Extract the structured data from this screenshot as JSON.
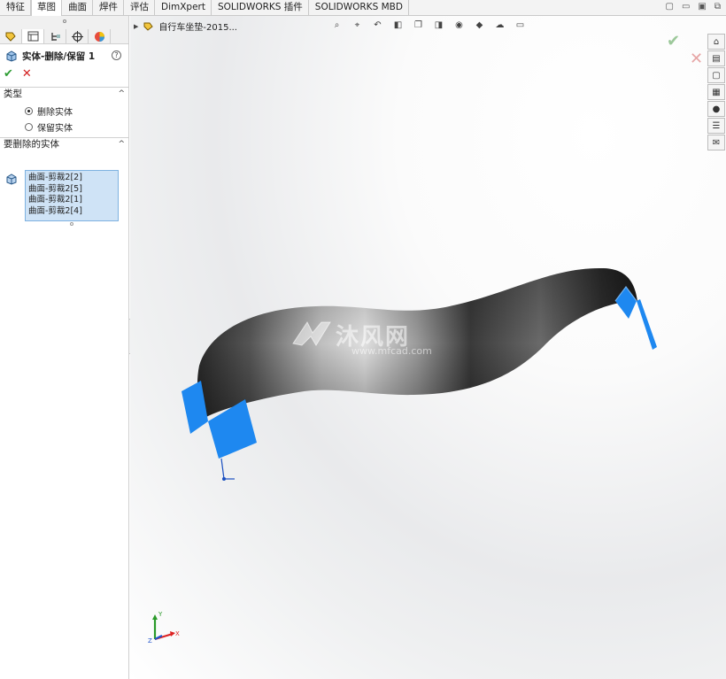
{
  "tabs": [
    {
      "label": "特征",
      "active": false
    },
    {
      "label": "草图",
      "active": true
    },
    {
      "label": "曲面",
      "active": false
    },
    {
      "label": "焊件",
      "active": false
    },
    {
      "label": "评估",
      "active": false
    },
    {
      "label": "DimXpert",
      "active": false
    },
    {
      "label": "SOLIDWORKS 插件",
      "active": false
    },
    {
      "label": "SOLIDWORKS MBD",
      "active": false
    }
  ],
  "property_manager": {
    "icons": [
      "feature-manager-icon",
      "property-manager-icon",
      "configuration-manager-icon",
      "dimxpert-manager-icon",
      "display-manager-icon"
    ],
    "feature_title": "实体-删除/保留 1",
    "help": "?",
    "ok": "✔",
    "cancel": "✕",
    "type_section": {
      "label": "类型",
      "options": [
        {
          "label": "删除实体",
          "selected": true
        },
        {
          "label": "保留实体",
          "selected": false
        }
      ]
    },
    "bodies_section": {
      "label": "要删除的实体",
      "items": [
        "曲面-剪裁2[2]",
        "曲面-剪裁2[5]",
        "曲面-剪裁2[1]",
        "曲面-剪裁2[4]"
      ]
    }
  },
  "viewport": {
    "tree_label": "自行车坐垫-2015...",
    "heads_up_icons": [
      "zoom-to-fit-icon",
      "zoom-area-icon",
      "previous-view-icon",
      "section-view-icon",
      "view-orientation-icon",
      "display-style-icon",
      "hide-show-icon",
      "edit-appearance-icon",
      "apply-scene-icon",
      "view-settings-icon"
    ],
    "watermark_cn": "沐风网",
    "watermark_url": "www.mfcad.com",
    "task_pane_icons": [
      "home-icon",
      "design-library-icon",
      "file-explorer-icon",
      "view-palette-icon",
      "appearances-icon",
      "custom-properties-icon",
      "forum-icon"
    ],
    "triad": {
      "x": "X",
      "y": "Y",
      "z": "Z"
    }
  },
  "colors": {
    "selected_surface": "#1e88f0",
    "model_dark": "#2b2b2b",
    "model_light": "#d9d9d9",
    "accent_ok": "#2f9d34",
    "accent_cancel": "#d32020"
  }
}
